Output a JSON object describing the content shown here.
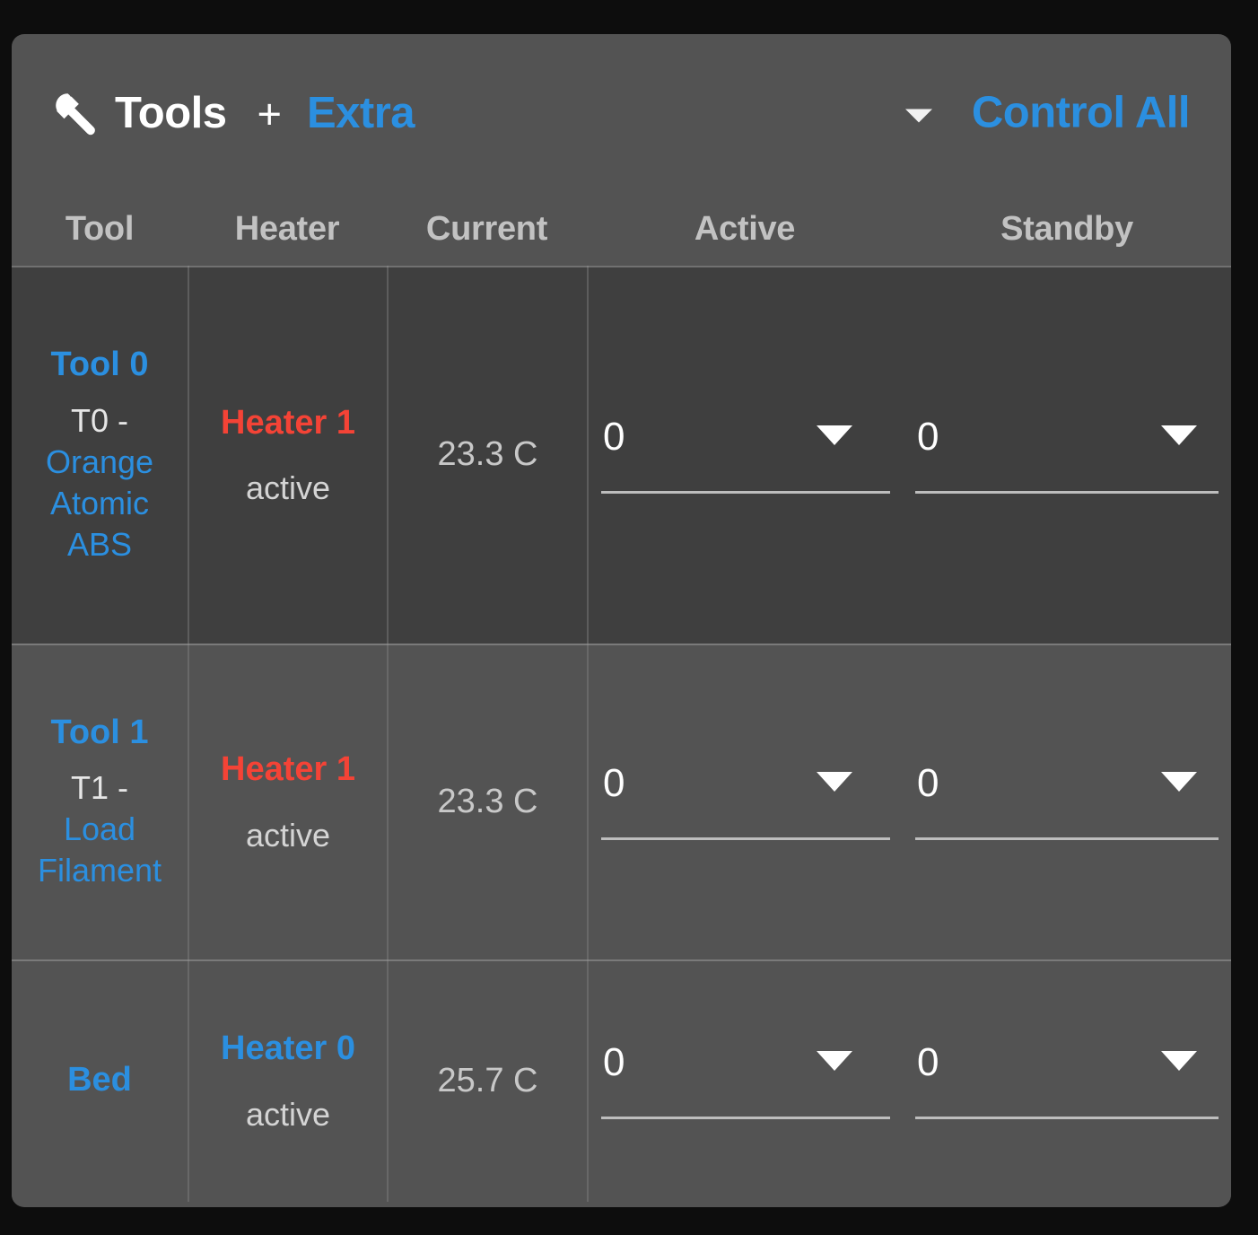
{
  "header": {
    "icon": "wrench-icon",
    "title": "Tools",
    "plus": "+",
    "extra_label": "Extra",
    "dropdown_icon": "chevron-down-icon",
    "control_all_label": "Control All"
  },
  "table": {
    "columns": [
      "Tool",
      "Heater",
      "Current",
      "Active",
      "Standby"
    ],
    "rows": [
      {
        "tool_name": "Tool 0",
        "tool_prefix": "T0 -",
        "tool_material": "Orange Atomic ABS",
        "heater_label": "Heater 1",
        "heater_state": "active",
        "heater_color": "#f44336",
        "current": "23.3 C",
        "active_value": "0",
        "standby_value": "0",
        "active_caret": "chevron-down-icon",
        "standby_caret": "chevron-down-icon"
      },
      {
        "tool_name": "Tool 1",
        "tool_prefix": "T1 -",
        "tool_material": "Load Filament",
        "heater_label": "Heater 1",
        "heater_state": "active",
        "heater_color": "#f44336",
        "current": "23.3 C",
        "active_value": "0",
        "standby_value": "0",
        "active_caret": "chevron-down-icon",
        "standby_caret": "chevron-down-icon"
      },
      {
        "tool_name": "Bed",
        "tool_prefix": "",
        "tool_material": "",
        "heater_label": "Heater 0",
        "heater_state": "active",
        "heater_color": "#2b8fe0",
        "current": "25.7 C",
        "active_value": "0",
        "standby_value": "0",
        "active_caret": "chevron-down-icon",
        "standby_caret": "chevron-down-icon"
      }
    ]
  },
  "colors": {
    "page_background": "#0d0d0d",
    "card_background": "#535353",
    "row_alt_background": "#3f3f3f",
    "accent_blue": "#2b8fe0",
    "hot_red": "#f44336",
    "header_text": "#c2c2c2",
    "value_text": "#ffffff"
  }
}
